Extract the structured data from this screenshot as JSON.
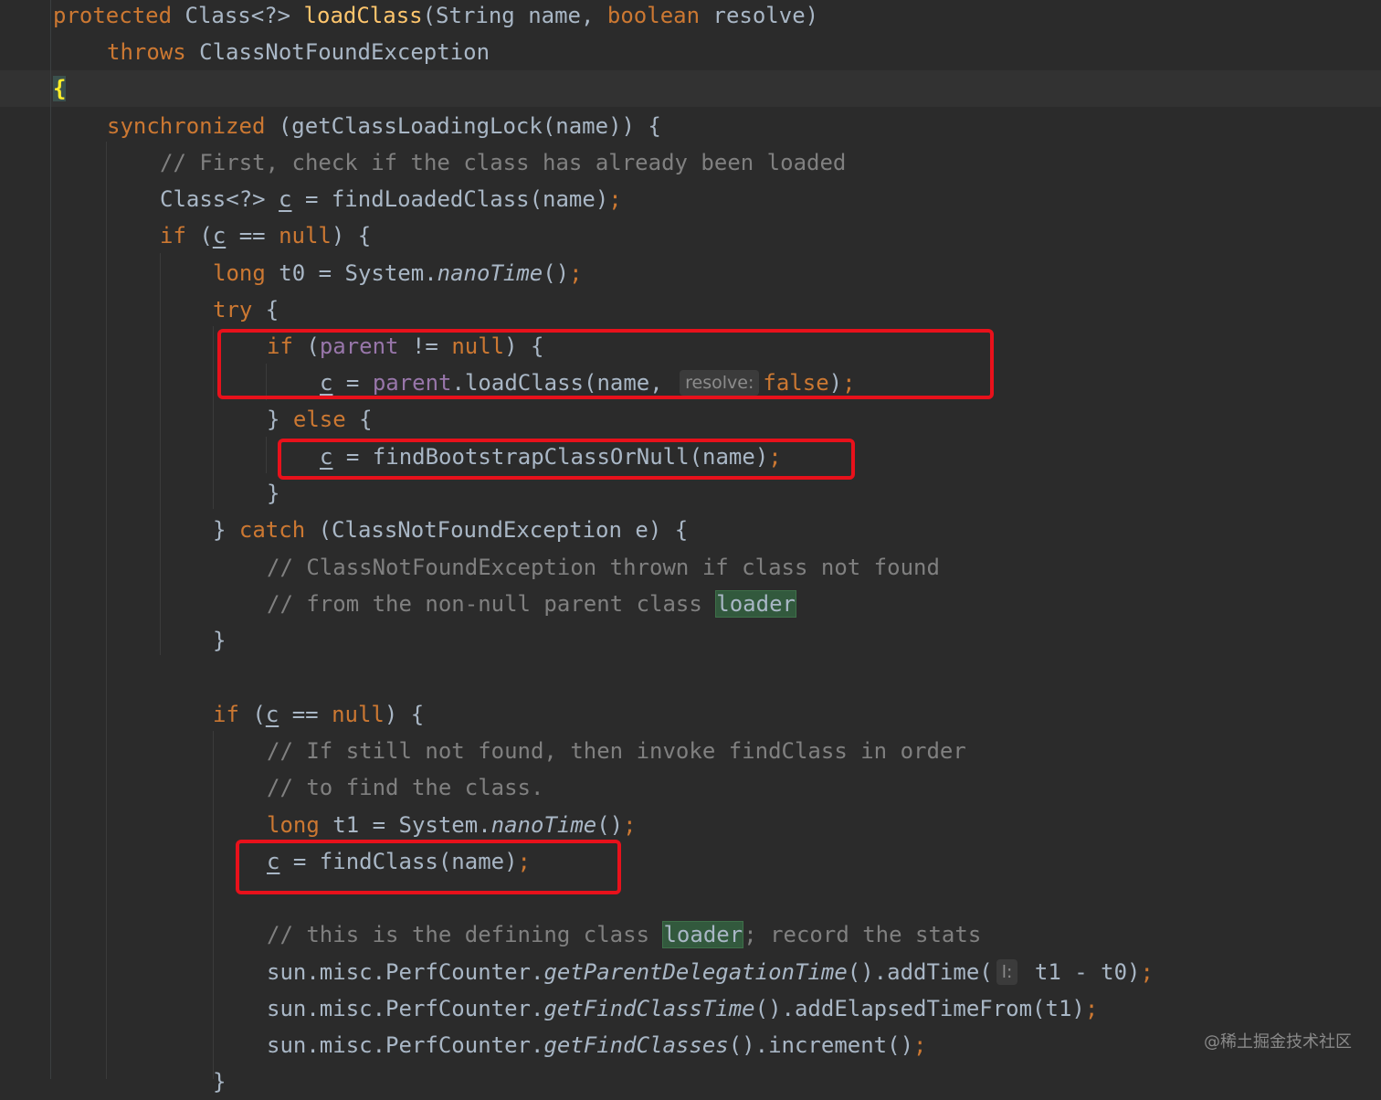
{
  "code": {
    "l1": {
      "kw1": "protected",
      "cls": " Class<?> ",
      "fn": "loadClass",
      "p1": "(String name, ",
      "kw2": "boolean",
      "p2": " resolve)"
    },
    "l2": {
      "kw": "throws",
      "rest": " ClassNotFoundException"
    },
    "l3": {
      "brace": "{"
    },
    "l4": {
      "kw": "synchronized",
      "rest": " (getClassLoadingLock(name)) {"
    },
    "l5": {
      "comment": "// First, check if the class has already been loaded"
    },
    "l6": {
      "a": "Class<?> ",
      "var": "c",
      "b": " = findLoadedClass(name)",
      "semi": ";"
    },
    "l7": {
      "kw": "if",
      "a": " (",
      "var": "c",
      "b": " == ",
      "kw2": "null",
      "c": ") {"
    },
    "l8": {
      "kw": "long",
      "a": " t0 = System.",
      "it": "nanoTime",
      "b": "()",
      "semi": ";"
    },
    "l9": {
      "kw": "try",
      "rest": " {"
    },
    "l10": {
      "kw": "if",
      "a": " (",
      "fld": "parent",
      "b": " != ",
      "kw2": "null",
      "c": ") {"
    },
    "l11": {
      "var": "c",
      "a": " = ",
      "fld": "parent",
      "b": ".loadClass(name, ",
      "hint": "resolve:",
      "kw": "false",
      "c": ")",
      "semi": ";"
    },
    "l12": {
      "a": "} ",
      "kw": "else",
      "b": " {"
    },
    "l13": {
      "var": "c",
      "a": " = findBootstrapClassOrNull(name)",
      "semi": ";"
    },
    "l14": {
      "a": "}"
    },
    "l15": {
      "a": "} ",
      "kw": "catch",
      "b": " (ClassNotFoundException e) {"
    },
    "l16": {
      "comment": "// ClassNotFoundException thrown if class not found"
    },
    "l17": {
      "comment": "// from the non-null parent class ",
      "match": "loader"
    },
    "l18": {
      "a": "}"
    },
    "l19": {
      "kw": "if",
      "a": " (",
      "var": "c",
      "b": " == ",
      "kw2": "null",
      "c": ") {"
    },
    "l20": {
      "comment": "// If still not found, then invoke findClass in order"
    },
    "l21": {
      "comment": "// to find the class."
    },
    "l22": {
      "kw": "long",
      "a": " t1 = System.",
      "it": "nanoTime",
      "b": "()",
      "semi": ";"
    },
    "l23": {
      "var": "c",
      "a": " = findClass(name)",
      "semi": ";"
    },
    "l24": {
      "comment": "// this is the defining class ",
      "match": "loader",
      "comment2": "; record the stats"
    },
    "l25": {
      "a": "sun.misc.PerfCounter.",
      "it": "getParentDelegationTime",
      "b": "().addTime(",
      "hint": "l:",
      "c": " t1 - t0)",
      "semi": ";"
    },
    "l26": {
      "a": "sun.misc.PerfCounter.",
      "it": "getFindClassTime",
      "b": "().addElapsedTimeFrom(t1)",
      "semi": ";"
    },
    "l27": {
      "a": "sun.misc.PerfCounter.",
      "it": "getFindClasses",
      "b": "().increment()",
      "semi": ";"
    },
    "l28": {
      "a": "}"
    }
  },
  "watermark": "@稀土掘金技术社区",
  "colors": {
    "background": "#2b2b2b",
    "keyword": "#cc7832",
    "function": "#ffc66d",
    "comment": "#808080",
    "field": "#9876aa",
    "highlight_box": "#e8111b"
  }
}
